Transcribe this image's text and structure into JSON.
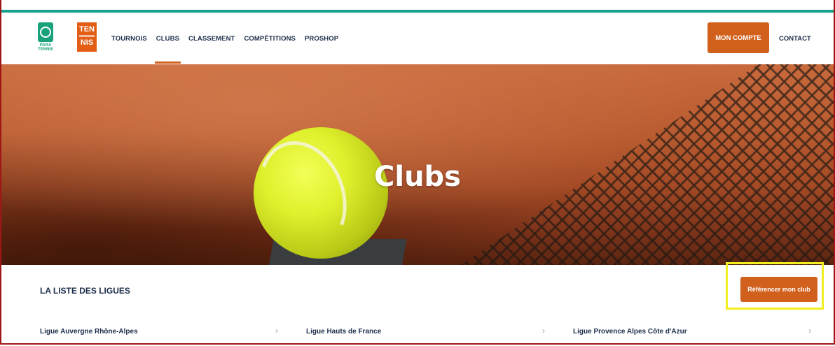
{
  "nav": {
    "logo_para_text": "PARA TENNIS",
    "logo_tennis_top": "TEN",
    "logo_tennis_bottom": "NIS",
    "items": [
      {
        "label": "TOURNOIS"
      },
      {
        "label": "CLUBS"
      },
      {
        "label": "CLASSEMENT"
      },
      {
        "label": "COMPÉTITIONS"
      },
      {
        "label": "PROSHOP"
      }
    ],
    "active_item": "CLUBS",
    "account_label": "MON COMPTE",
    "contact_label": "CONTACT"
  },
  "hero": {
    "title": "Clubs"
  },
  "section": {
    "title": "LA LISTE DES LIGUES",
    "reference_button": "Référencer mon club",
    "ligues": [
      {
        "label": "Ligue Auvergne Rhône-Alpes"
      },
      {
        "label": "Ligue Hauts de France"
      },
      {
        "label": "Ligue Provence Alpes Côte d'Azur"
      }
    ]
  },
  "colors": {
    "accent": "#d2601d",
    "topbar": "#17a08a",
    "navy": "#1c2d4a",
    "highlight": "#f1ef1f"
  }
}
